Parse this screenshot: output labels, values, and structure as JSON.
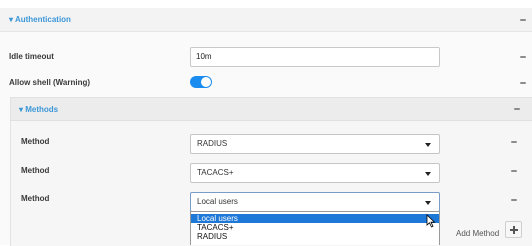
{
  "authentication": {
    "header": "▾ Authentication",
    "idle_timeout": {
      "label": "Idle timeout",
      "value": "10m"
    },
    "allow_shell": {
      "label": "Allow shell (Warning)",
      "enabled": true
    }
  },
  "methods": {
    "header": "▾ Methods",
    "items": [
      {
        "label": "Method",
        "value": "RADIUS"
      },
      {
        "label": "Method",
        "value": "TACACS+"
      },
      {
        "label": "Method",
        "value": "Local users"
      }
    ],
    "dropdown_options": [
      "Local users",
      "TACACS+",
      "RADIUS"
    ],
    "add_label": "Add Method"
  },
  "colors": {
    "accent": "#3c97d8",
    "toggle_on": "#1a8cf0",
    "selection": "#1e78d7"
  }
}
